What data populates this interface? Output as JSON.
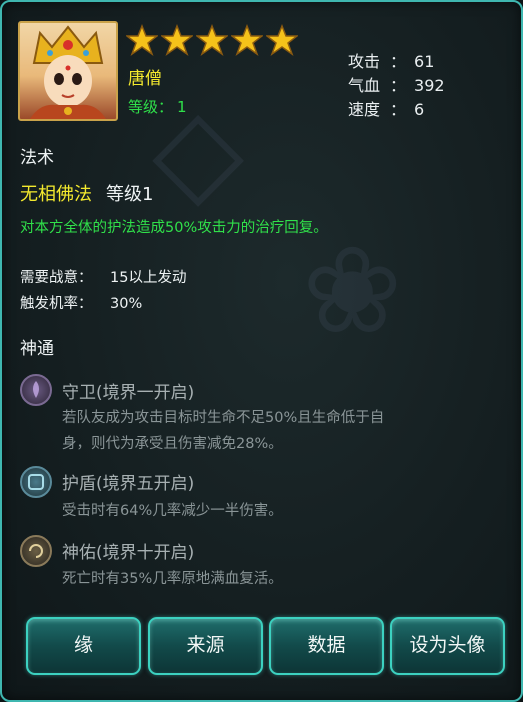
{
  "character": {
    "name": "唐僧",
    "level_label": "等级：",
    "level_value": "1",
    "stars": 5,
    "star_color": "#f5c21a"
  },
  "stats": [
    {
      "label": "攻击",
      "colon": "：",
      "value": "61"
    },
    {
      "label": "气血",
      "colon": "：",
      "value": "392"
    },
    {
      "label": "速度",
      "colon": "：",
      "value": "6"
    }
  ],
  "spell": {
    "section_title": "法术",
    "name": "无相佛法",
    "level": "等级1",
    "description": "对本方全体的护法造成50%攻击力的治疗回复。",
    "requirement_label": "需要战意：",
    "requirement_value": "15以上发动",
    "trigger_label": "触发机率：",
    "trigger_value": "30%"
  },
  "divine": {
    "section_title": "神通",
    "items": [
      {
        "icon": "guard-icon",
        "title": "守卫(境界一开启)",
        "desc_line1": "若队友成为攻击目标时生命不足50%且生命低于自",
        "desc_line2": "身，则代为承受且伤害减免28%。"
      },
      {
        "icon": "shield-icon",
        "title": "护盾(境界五开启)",
        "desc_line1": "受击时有64%几率减少一半伤害。",
        "desc_line2": ""
      },
      {
        "icon": "blessing-icon",
        "title": "神佑(境界十开启)",
        "desc_line1": "死亡时有35%几率原地满血复活。",
        "desc_line2": ""
      }
    ]
  },
  "buttons": {
    "fate": "缘",
    "source": "来源",
    "data": "数据",
    "set_avatar": "设为头像"
  },
  "colors": {
    "accent": "#3fb7b0",
    "name_yellow": "#f3e92e",
    "green_text": "#2fe04a"
  }
}
